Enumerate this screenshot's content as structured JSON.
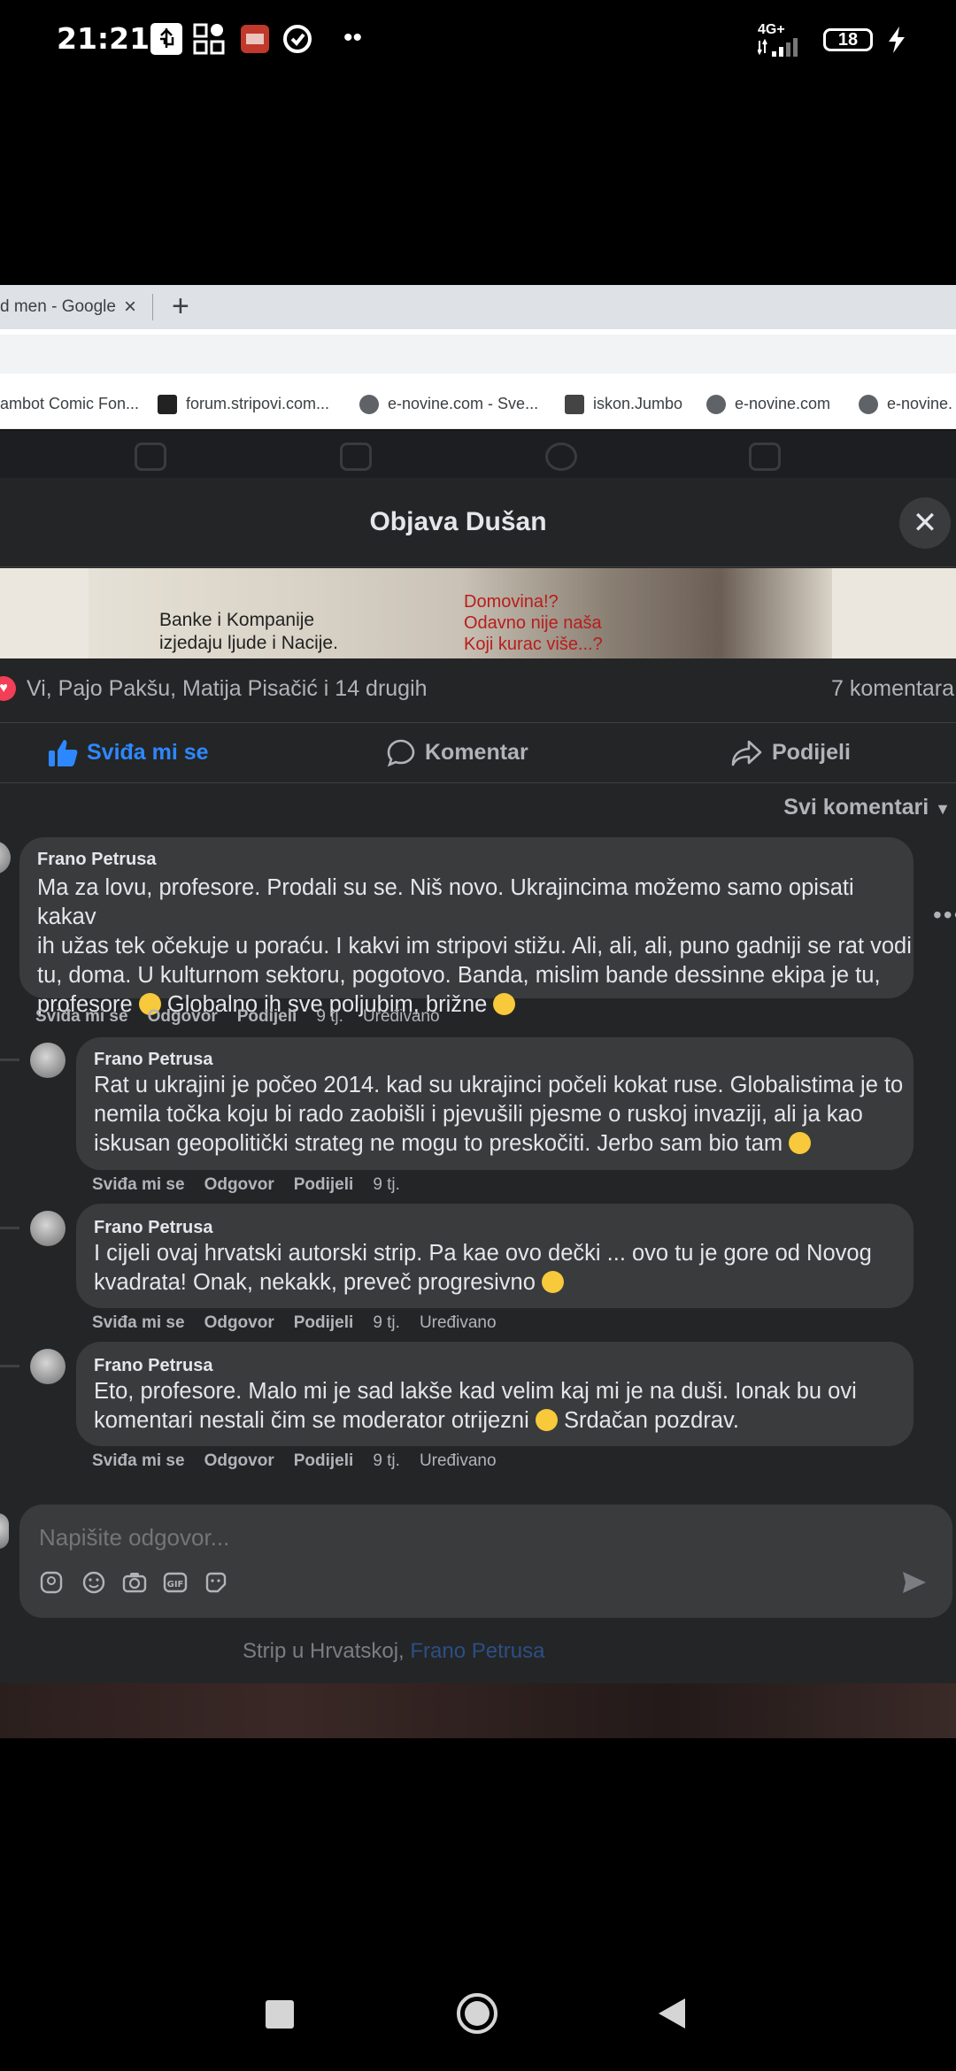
{
  "status_bar": {
    "time": "21:21",
    "network": "4G+",
    "battery": "18"
  },
  "browser": {
    "tab_title": "d men - Google",
    "tab_close": "×",
    "new_tab": "+",
    "bookmarks": [
      "ambot Comic Fon...",
      "forum.stripovi.com...",
      "e-novine.com - Sve...",
      "iskon.Jumbo",
      "e-novine.com",
      "e-novine."
    ]
  },
  "dialog": {
    "title": "Objava Dušan",
    "close_label": "✕",
    "image_text_left": [
      "Banke i Kompanije",
      "izjedaju  ljude i Nacije."
    ],
    "image_text_right": [
      "Domovina!?",
      "Odavno nije naša",
      "Koji kurac više...?"
    ],
    "reactions_text": "Vi, Pajo Pakšu, Matija Pisačić i 14 drugih",
    "comments_count": "7 komentara",
    "actions": {
      "like": "Sviđa mi se",
      "comment": "Komentar",
      "share": "Podijeli"
    },
    "sort_label": "Svi komentari",
    "reply_placeholder": "Napišite odgovor..."
  },
  "comments": [
    {
      "author": "Frano Petrusa",
      "lines": [
        "Ma za lovu, profesore. Prodali su se. Niš novo. Ukrajincima možemo samo opisati kakav",
        "ih užas tek očekuje u poraću. I kakvi im stripovi stižu. Ali, ali, ali, puno gadniji se rat vodi",
        "tu, doma. U kulturnom sektoru, pogotovo. Banda, mislim bande dessinne ekipa je tu,",
        "profesore",
        "Globalno ih sve poljubim, brižne"
      ],
      "like": "Sviđa mi se",
      "reply": "Odgovor",
      "share": "Podijeli",
      "time": "9 tj.",
      "edited": "Uređivano"
    },
    {
      "author": "Frano Petrusa",
      "lines": [
        "Rat u ukrajini je počeo 2014. kad su ukrajinci počeli kokat ruse. Globalistima je to",
        "nemila točka koju bi rado zaobišli i pjevušili pjesme o ruskoj invaziji, ali ja kao",
        "iskusan geopolitički strateg ne mogu to preskočiti. Jerbo sam bio tam"
      ],
      "like": "Sviđa mi se",
      "reply": "Odgovor",
      "share": "Podijeli",
      "time": "9 tj.",
      "edited": ""
    },
    {
      "author": "Frano Petrusa",
      "lines": [
        "I cijeli ovaj hrvatski autorski strip. Pa kae ovo dečki ... ovo tu je gore od Novog",
        "kvadrata! Onak, nekakk, preveč progresivno"
      ],
      "like": "Sviđa mi se",
      "reply": "Odgovor",
      "share": "Podijeli",
      "time": "9 tj.",
      "edited": "Uređivano"
    },
    {
      "author": "Frano Petrusa",
      "lines": [
        "Eto, profesore. Malo mi je sad lakše kad velim kaj mi je na duši. Ionak bu ovi",
        "komentari nestali čim se moderator otrijezni",
        "Srdačan pozdrav."
      ],
      "like": "Sviđa mi se",
      "reply": "Odgovor",
      "share": "Podijeli",
      "time": "9 tj.",
      "edited": "Uređivano"
    }
  ],
  "background_post": {
    "text": "Strip u Hrvatskoj, ",
    "link": "Frano Petrusa"
  },
  "colors": {
    "dialog_bg": "#242526",
    "bubble": "#3a3b3c",
    "accent": "#2d88ff",
    "heart": "#f33e58"
  }
}
